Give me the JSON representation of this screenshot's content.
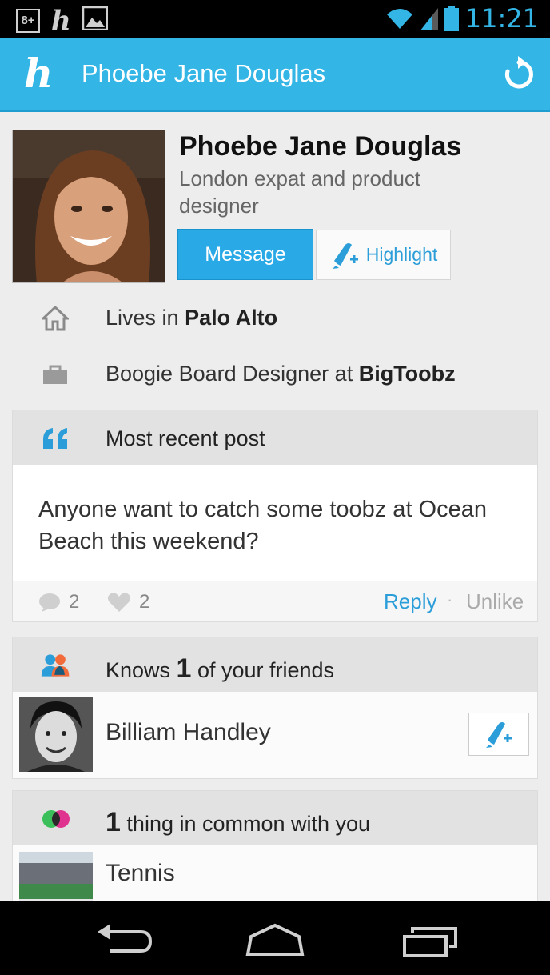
{
  "status": {
    "time": "11:21",
    "left_icons": [
      "google-plus-icon",
      "h-app-icon",
      "image-icon"
    ],
    "right_icons": [
      "wifi-icon",
      "signal-icon",
      "battery-icon"
    ],
    "gplus_text": "8+",
    "h_text": "h"
  },
  "appbar": {
    "logo": "h",
    "title": "Phoebe Jane Douglas",
    "refresh_icon": "refresh-icon",
    "color": "#33b5e5"
  },
  "profile": {
    "name": "Phoebe Jane Douglas",
    "tagline": "London expat and product designer",
    "message_label": "Message",
    "highlight_label": "Highlight",
    "lives_prefix": "Lives in ",
    "lives_place": "Palo Alto",
    "job_prefix": "Boogie Board Designer at ",
    "job_company": "BigToobz"
  },
  "post": {
    "header": "Most recent post",
    "text": "Anyone want to catch some toobz at Ocean Beach this weekend?",
    "comments": "2",
    "likes": "2",
    "reply_label": "Reply",
    "separator": "·",
    "unlike_label": "Unlike"
  },
  "friends": {
    "header_prefix": "Knows ",
    "count": "1",
    "header_suffix": " of your friends",
    "items": [
      {
        "name": "Billiam Handley"
      }
    ]
  },
  "common": {
    "count": "1",
    "header_suffix": " thing in common with you",
    "items": [
      {
        "name": "Tennis"
      }
    ]
  },
  "navbar": {
    "icons": [
      "back-icon",
      "home-icon",
      "recent-apps-icon"
    ]
  },
  "colors": {
    "accent": "#33b5e5",
    "link": "#2b9ed9"
  }
}
